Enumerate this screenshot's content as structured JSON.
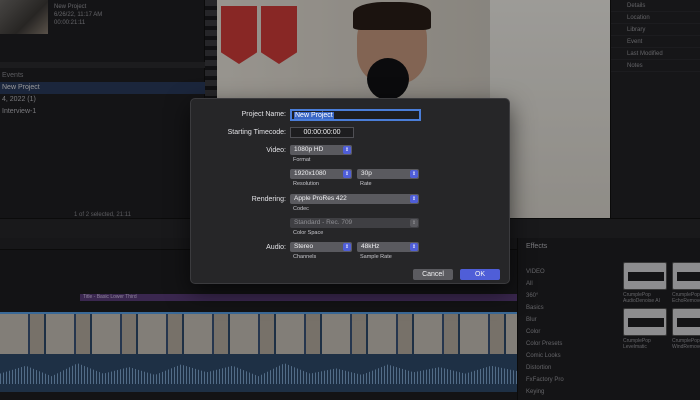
{
  "browser": {
    "clip_meta": [
      "New Project",
      "6/26/22, 11:17 AM",
      "00:00:21:11"
    ],
    "events_header": "Events",
    "events": [
      {
        "label": "New Project",
        "selected": true
      },
      {
        "label": "4, 2022  (1)",
        "selected": false
      },
      {
        "label": "Interview-1",
        "selected": false
      }
    ],
    "status": "1 of 2 selected, 21:11"
  },
  "inspector": {
    "items": [
      "Details",
      "Location",
      "Library",
      "Event",
      "Last Modified",
      "Notes"
    ]
  },
  "timeline": {
    "title_clip": "Title - Basic Lower Third"
  },
  "effects": {
    "title": "Effects",
    "categories": [
      "VIDEO",
      "All",
      "360°",
      "Basics",
      "Blur",
      "Color",
      "Color Presets",
      "Comic Looks",
      "Distortion",
      "FxFactory Pro",
      "Keying"
    ],
    "tiles": [
      "CrumplePop AudioDenoise AI",
      "CrumplePop EchoRemover AI",
      "CrumplePop Levelmatic",
      "CrumplePop WindRemover AI"
    ]
  },
  "dialog": {
    "project_name_label": "Project Name:",
    "project_name_value": "New Project",
    "timecode_label": "Starting Timecode:",
    "timecode_value": "00:00:00:00",
    "video_label": "Video:",
    "video_format": "1080p HD",
    "format_caption": "Format",
    "resolution": "1920x1080",
    "resolution_caption": "Resolution",
    "rate": "30p",
    "rate_caption": "Rate",
    "rendering_label": "Rendering:",
    "codec": "Apple ProRes 422",
    "codec_caption": "Codec",
    "color_space": "Standard - Rec. 709",
    "color_space_caption": "Color Space",
    "audio_label": "Audio:",
    "channels": "Stereo",
    "channels_caption": "Channels",
    "sample_rate": "48kHz",
    "sample_rate_caption": "Sample Rate",
    "cancel_label": "Cancel",
    "ok_label": "OK"
  },
  "colors": {
    "accent": "#4f5ed8",
    "selection": "#3a67c6"
  }
}
